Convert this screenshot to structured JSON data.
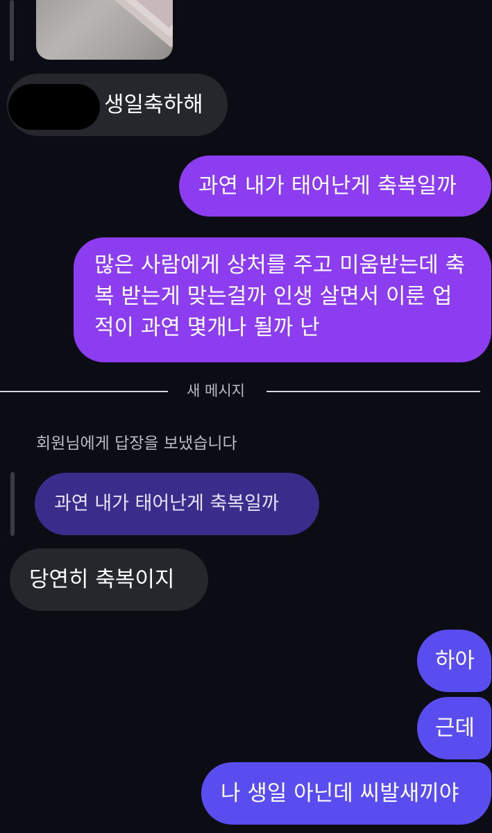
{
  "photo_message": {
    "icon": "photo-thumbnail"
  },
  "messages": {
    "greeting": "생일축하해",
    "sent_question": "과연 내가 태어난게 축복일까",
    "sent_long": "많은 사람에게 상처를 주고 미움받는데 축복 받는게 맞는걸까 인생 살면서 이룬 업적이 과연 몇개나 될까 난",
    "divider_label": "새 메시지",
    "reply_caption": "회원님에게 답장을 보냈습니다",
    "quoted_reply": "과연 내가 태어난게 축복일까",
    "answer": "당연히 축복이지",
    "sent_sigh": "하아",
    "sent_but": "근데",
    "sent_final": "나 생일 아닌데 씨발새끼야"
  },
  "colors": {
    "background": "#0c0c14",
    "received_bubble": "#26262d",
    "sent_violet": "#8c3df0",
    "sent_blue": "#5a4df0",
    "quoted_bubble": "#3a2c8a"
  }
}
